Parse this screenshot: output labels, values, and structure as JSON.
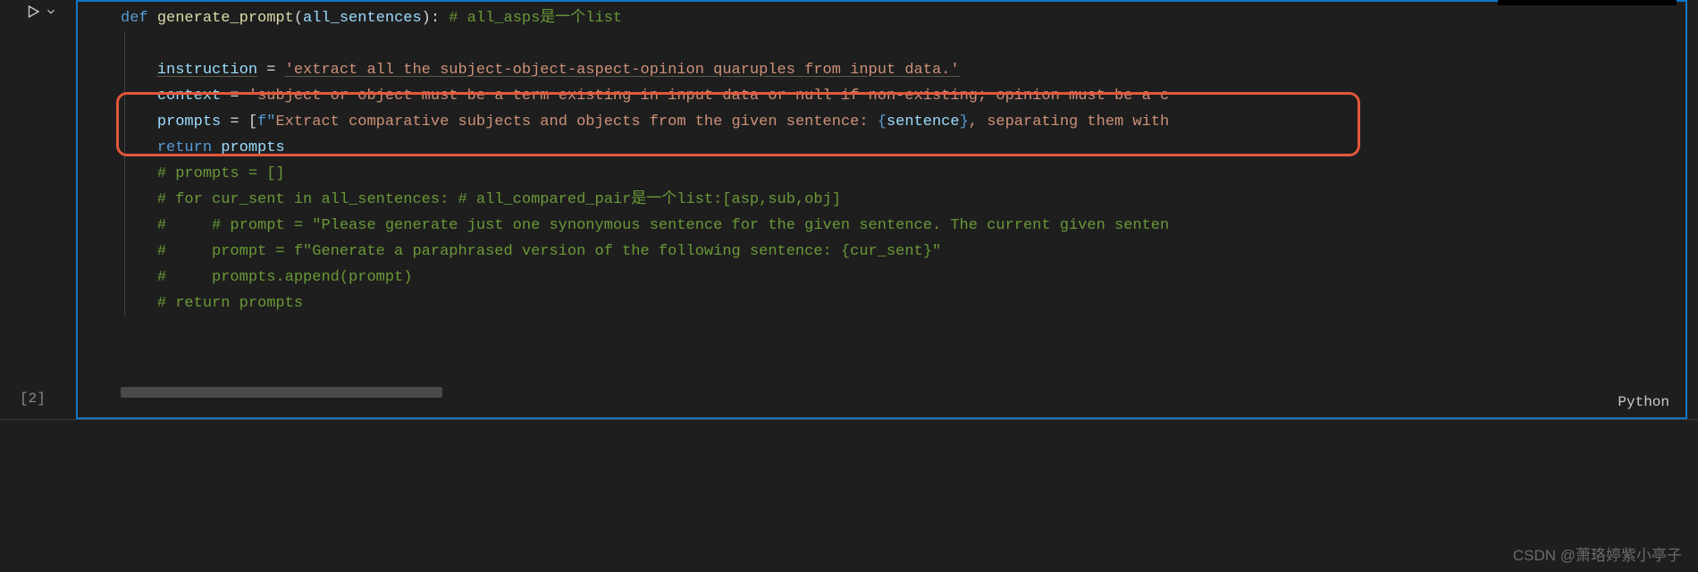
{
  "cell": {
    "exec_label": "[2]",
    "language": "Python"
  },
  "code": {
    "l1": {
      "kw": "def ",
      "fn": "generate_prompt",
      "p1": "(",
      "param": "all_sentences",
      "p2": "): ",
      "cmt": "# all_asps是一个list"
    },
    "l3": {
      "var": "instruction",
      "eq": " = ",
      "str": "'extract all the subject-object-aspect-opinion quaruples from input data.'"
    },
    "l4": {
      "var": "context",
      "eq": " = ",
      "str": "'subject or object must be a term existing in input data or null if non-existing; opinion must be a c"
    },
    "l5": {
      "var": "prompts",
      "eq": " = [",
      "fpre": "f\"",
      "s1": "Extract comparative subjects and objects from the given sentence: ",
      "br1": "{",
      "v1": "sentence",
      "br2": "}",
      "s2": ", separating them with"
    },
    "l6": {
      "kw": "return ",
      "var": "prompts"
    },
    "l7": "# prompts = []",
    "l8": "# for cur_sent in all_sentences: # all_compared_pair是一个list:[asp,sub,obj]",
    "l9": "#     # prompt = \"Please generate just one synonymous sentence for the given sentence. The current given senten",
    "l10": "#     prompt = f\"Generate a paraphrased version of the following sentence: {cur_sent}\"",
    "l11": "#     prompts.append(prompt)",
    "l12": "# return prompts"
  },
  "watermark": "CSDN @萧珞婷紫小亭子"
}
